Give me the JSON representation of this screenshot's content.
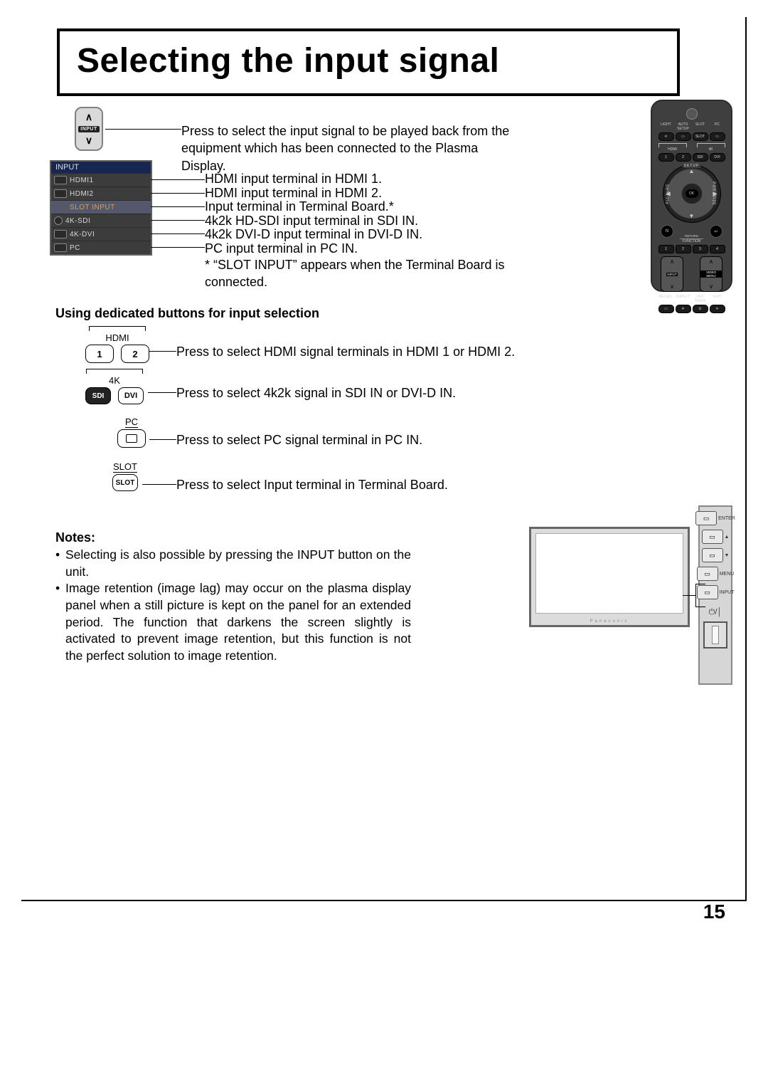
{
  "page_number": "15",
  "title": "Selecting the input signal",
  "input_rocker_label": "INPUT",
  "first_desc": "Press to select the input signal to be played back from the equipment which has been connected to the Plasma Display.",
  "osd": {
    "header": "INPUT",
    "rows": [
      {
        "label": "HDMI1",
        "desc": "HDMI input terminal in HDMI 1."
      },
      {
        "label": "HDMI2",
        "desc": "HDMI input terminal in HDMI 2."
      },
      {
        "label": "SLOT INPUT",
        "desc": "Input terminal in Terminal Board.*"
      },
      {
        "label": "4K-SDI",
        "desc": "4k2k HD-SDI input terminal in SDI IN."
      },
      {
        "label": "4K-DVI",
        "desc": "4k2k DVI-D input terminal in DVI-D IN."
      },
      {
        "label": "PC",
        "desc": "PC input terminal in PC IN."
      }
    ],
    "footnote": "* “SLOT INPUT” appears when the Terminal Board is connected."
  },
  "subhead": "Using dedicated buttons for input selection",
  "clusters": {
    "hdmi": {
      "group_label": "HDMI",
      "btn1": "1",
      "btn2": "2",
      "desc": "Press to select HDMI signal terminals in HDMI 1 or HDMI 2."
    },
    "fourk": {
      "group_label": "4K",
      "btn1": "SDI",
      "btn2": "DVI",
      "desc": "Press to select 4k2k signal in SDI IN or DVI-D IN."
    },
    "pc": {
      "label": "PC",
      "desc": "Press to select PC signal terminal in PC IN."
    },
    "slot": {
      "label": "SLOT",
      "btn": "SLOT",
      "desc": "Press to select Input terminal in Terminal Board."
    }
  },
  "notes_head": "Notes:",
  "notes": [
    "Selecting is also possible by pressing the INPUT button on the unit.",
    "Image retention (image lag) may occur on the plasma display panel when a still picture is kept on the panel for an extended period. The function that darkens the screen slightly is activated to prevent image retention, but this function is not the perfect solution to image retention."
  ],
  "remote": {
    "row1_labels": [
      "LIGHT",
      "AUTO SETUP",
      "SLOT",
      "PC"
    ],
    "row2_group_left": "HDMI",
    "row2_group_right": "4K",
    "row2_btns": [
      "1",
      "2",
      "SDI",
      "DVI"
    ],
    "arc_top": "SETUP",
    "arc_left": "PICTURE",
    "arc_right": "POS./SIZE",
    "ok": "OK",
    "n_label": "N",
    "return_label": "RETURN",
    "function_label": "FUNCTION",
    "function_btns": [
      "1",
      "2",
      "3",
      "4"
    ],
    "rocker_left": "INPUT",
    "rocker_right": "VIDEO MENU",
    "bottom_labels": [
      "RECALL",
      "ASPECT",
      "OFF TIMER",
      "EXIT"
    ]
  },
  "ctrl_panel": {
    "enter": "ENTER",
    "menu": "MENU",
    "input": "INPUT"
  },
  "tv_brand": "Panasonic"
}
